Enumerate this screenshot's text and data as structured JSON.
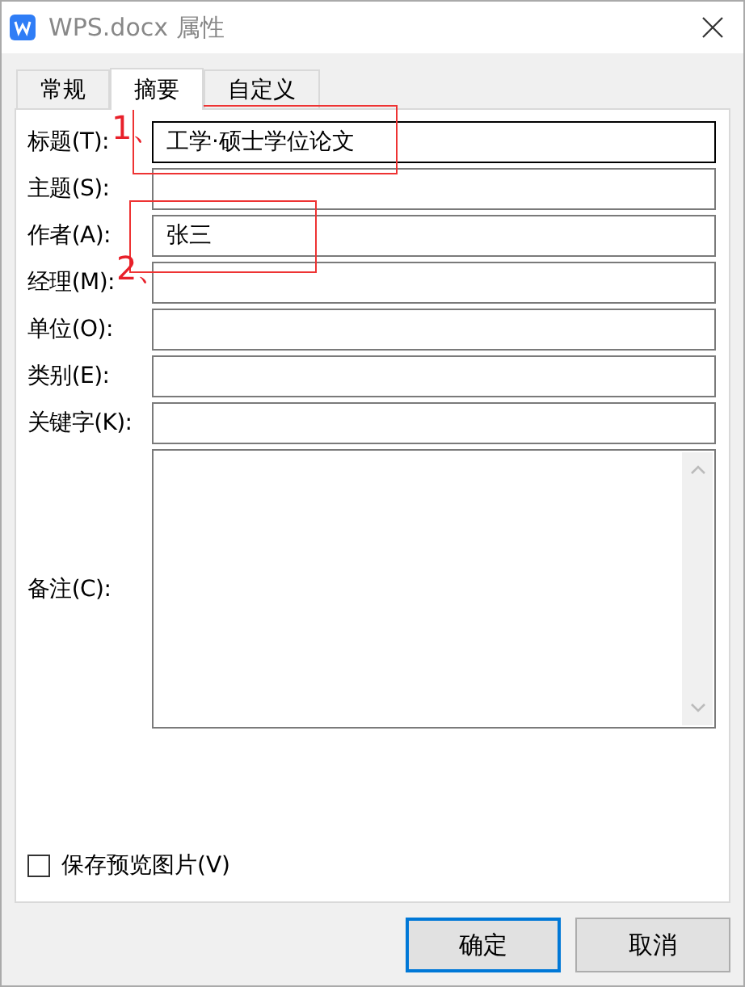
{
  "window": {
    "title": "WPS.docx 属性"
  },
  "tabs": [
    {
      "label": "常规",
      "selected": false
    },
    {
      "label": "摘要",
      "selected": true
    },
    {
      "label": "自定义",
      "selected": false
    }
  ],
  "fields": [
    {
      "label": "标题(T):",
      "value": "工学·硕士学位论文",
      "focused": true,
      "kind": "line"
    },
    {
      "label": "主题(S):",
      "focused": false,
      "kind": "line"
    },
    {
      "label": "作者(A):",
      "value": "张三",
      "focused": false,
      "kind": "line"
    },
    {
      "label": "经理(M):",
      "focused": false,
      "kind": "line"
    },
    {
      "label": "单位(O):",
      "focused": false,
      "kind": "line"
    },
    {
      "label": "类别(E):",
      "focused": false,
      "kind": "line"
    },
    {
      "label": "关键字(K):",
      "focused": false,
      "kind": "line"
    },
    {
      "label": "备注(C):",
      "focused": false,
      "kind": "multiline"
    }
  ],
  "save_preview": {
    "label": "保存预览图片(V)",
    "checked": false
  },
  "buttons": [
    {
      "label": "确定",
      "default": true
    },
    {
      "label": "取消",
      "default": false
    }
  ],
  "annotations": [
    {
      "label": "1、"
    },
    {
      "label": "2、"
    }
  ]
}
